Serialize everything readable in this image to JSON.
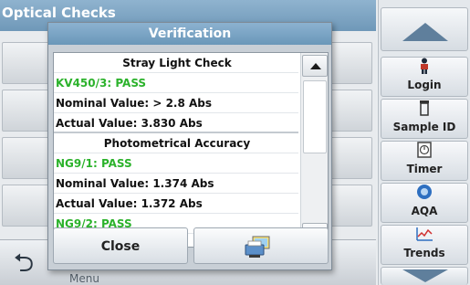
{
  "app": {
    "title": "Optical Checks",
    "bottom_label": "Menu"
  },
  "dialog": {
    "title": "Verification",
    "close_label": "Close",
    "print_icon": "printer-computer-icon",
    "list": [
      {
        "type": "header",
        "text": "Stray Light Check"
      },
      {
        "type": "pass",
        "text": "KV450/3: PASS"
      },
      {
        "type": "value",
        "text": "Nominal Value: > 2.8 Abs"
      },
      {
        "type": "value",
        "text": "Actual Value:  3.830 Abs"
      },
      {
        "type": "header",
        "text": "Photometrical Accuracy"
      },
      {
        "type": "pass",
        "text": "NG9/1: PASS"
      },
      {
        "type": "value",
        "text": "Nominal Value:  1.374 Abs"
      },
      {
        "type": "value",
        "text": "Actual Value:  1.372 Abs"
      },
      {
        "type": "pass",
        "text": "NG9/2: PASS"
      }
    ]
  },
  "sidebar": {
    "buttons": [
      {
        "label": "Login",
        "icon": "person-icon"
      },
      {
        "label": "Sample ID",
        "icon": "vial-icon"
      },
      {
        "label": "Timer",
        "icon": "timer-icon"
      },
      {
        "label": "AQA",
        "icon": "aqa-icon"
      },
      {
        "label": "Trends",
        "icon": "trends-chart-icon"
      }
    ]
  },
  "colors": {
    "title_bar": "#6f98b8",
    "pass_green": "#2bb22b",
    "arrow_blue": "#5f7f9c"
  }
}
